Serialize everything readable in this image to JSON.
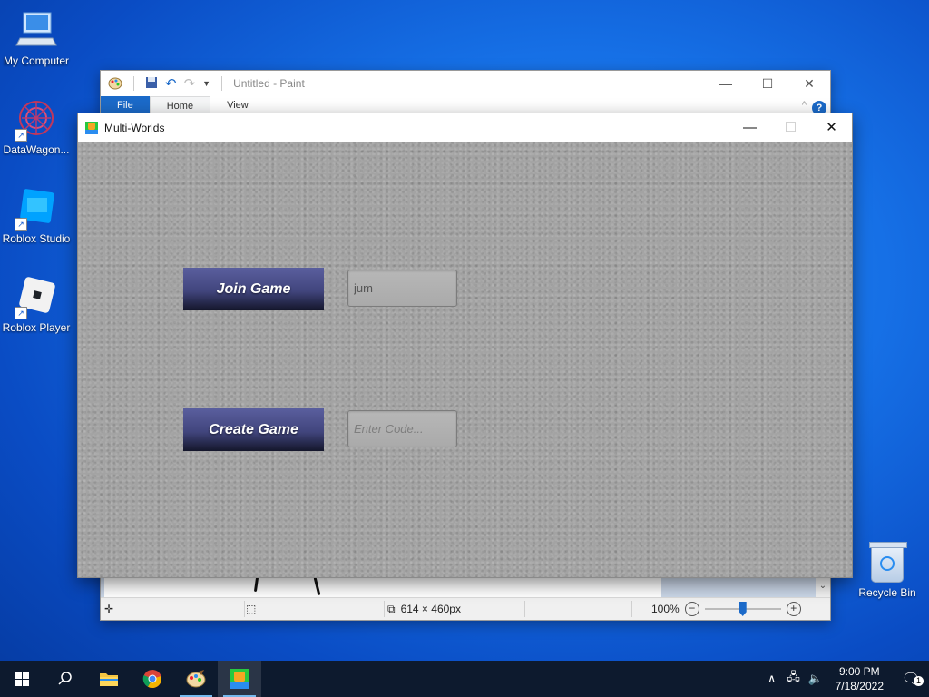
{
  "desktop": {
    "icons": [
      {
        "label": "My Computer"
      },
      {
        "label": "DataWagon..."
      },
      {
        "label": "Roblox Studio"
      },
      {
        "label": "Roblox Player"
      }
    ],
    "recycle_bin": {
      "label": "Recycle Bin"
    }
  },
  "paint": {
    "title": "Untitled - Paint",
    "tabs": [
      "File",
      "Home",
      "View"
    ],
    "status": {
      "canvas_size": "614 × 460px",
      "zoom": "100%"
    }
  },
  "multiworlds": {
    "title": "Multi-Worlds",
    "join_button": "Join Game",
    "join_input_value": "jum",
    "create_button": "Create Game",
    "create_input_placeholder": "Enter Code..."
  },
  "taskbar": {
    "clock_time": "9:00 PM",
    "clock_date": "7/18/2022",
    "notification_count": "1"
  }
}
